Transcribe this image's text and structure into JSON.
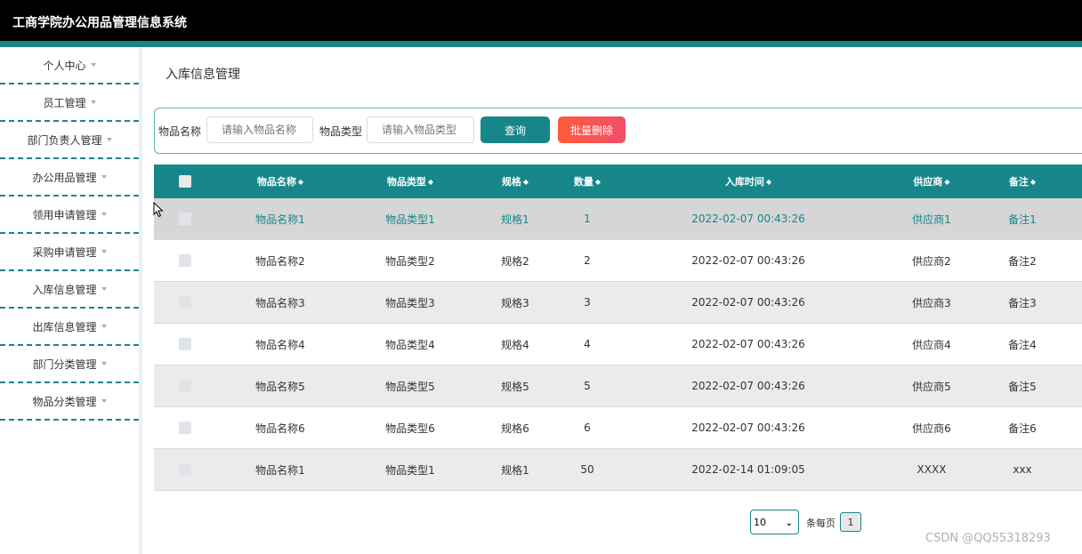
{
  "app": {
    "title": "工商学院办公用品管理信息系统"
  },
  "sidebar": {
    "items": [
      {
        "label": "个人中心"
      },
      {
        "label": "员工管理"
      },
      {
        "label": "部门负责人管理"
      },
      {
        "label": "办公用品管理"
      },
      {
        "label": "领用申请管理"
      },
      {
        "label": "采购申请管理"
      },
      {
        "label": "入库信息管理"
      },
      {
        "label": "出库信息管理"
      },
      {
        "label": "部门分类管理"
      },
      {
        "label": "物品分类管理"
      }
    ]
  },
  "page": {
    "title": "入库信息管理"
  },
  "search": {
    "name_label": "物品名称",
    "name_placeholder": "请输入物品名称",
    "type_label": "物品类型",
    "type_placeholder": "请输入物品类型",
    "query_label": "查询",
    "batch_delete_label": "批量删除"
  },
  "table": {
    "columns": [
      "物品名称",
      "物品类型",
      "规格",
      "数量",
      "入库时间",
      "供应商",
      "备注"
    ],
    "rows": [
      {
        "name": "物品名称1",
        "type": "物品类型1",
        "spec": "规格1",
        "qty": "1",
        "time": "2022-02-07 00:43:26",
        "supplier": "供应商1",
        "note": "备注1"
      },
      {
        "name": "物品名称2",
        "type": "物品类型2",
        "spec": "规格2",
        "qty": "2",
        "time": "2022-02-07 00:43:26",
        "supplier": "供应商2",
        "note": "备注2"
      },
      {
        "name": "物品名称3",
        "type": "物品类型3",
        "spec": "规格3",
        "qty": "3",
        "time": "2022-02-07 00:43:26",
        "supplier": "供应商3",
        "note": "备注3"
      },
      {
        "name": "物品名称4",
        "type": "物品类型4",
        "spec": "规格4",
        "qty": "4",
        "time": "2022-02-07 00:43:26",
        "supplier": "供应商4",
        "note": "备注4"
      },
      {
        "name": "物品名称5",
        "type": "物品类型5",
        "spec": "规格5",
        "qty": "5",
        "time": "2022-02-07 00:43:26",
        "supplier": "供应商5",
        "note": "备注5"
      },
      {
        "name": "物品名称6",
        "type": "物品类型6",
        "spec": "规格6",
        "qty": "6",
        "time": "2022-02-07 00:43:26",
        "supplier": "供应商6",
        "note": "备注6"
      },
      {
        "name": "物品名称1",
        "type": "物品类型1",
        "spec": "规格1",
        "qty": "50",
        "time": "2022-02-14 01:09:05",
        "supplier": "XXXX",
        "note": "xxx"
      }
    ]
  },
  "pagination": {
    "page_size": "10",
    "per_page_label": "条每页",
    "current_page": "1"
  },
  "watermark": "CSDN @QQ55318293",
  "colors": {
    "primary": "#17868a",
    "danger": "#ff5a3c",
    "header_bg": "#000000"
  }
}
